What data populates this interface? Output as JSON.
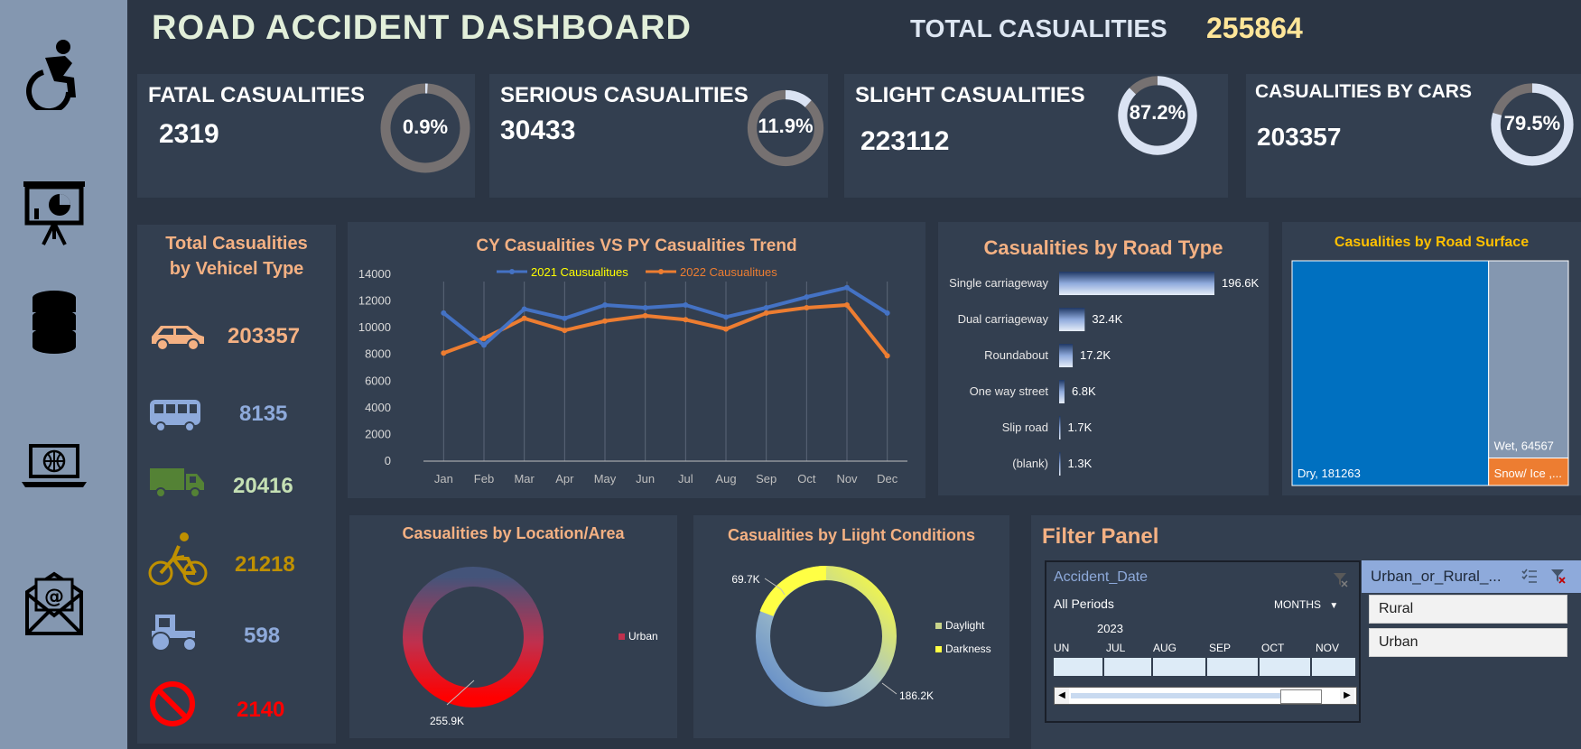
{
  "header": {
    "title": "ROAD ACCIDENT DASHBOARD",
    "total_label": "TOTAL CASUALITIES",
    "total_value": "255864"
  },
  "sidebar": {
    "icons": [
      "accessibility-icon",
      "presentation-chart-icon",
      "database-icon",
      "laptop-globe-icon",
      "email-icon"
    ]
  },
  "kpis": [
    {
      "title": "FATAL CASUALITIES",
      "value": "2319",
      "percent_label": "0.9%",
      "percent": 0.009
    },
    {
      "title": "SERIOUS CASUALITIES",
      "value": "30433",
      "percent_label": "11.9%",
      "percent": 0.119
    },
    {
      "title": "SLIGHT CASUALITIES",
      "value": "223112",
      "percent_label": "87.2%",
      "percent": 0.872
    },
    {
      "title": "CASUALITIES BY CARS",
      "value": "203357",
      "percent_label": "79.5%",
      "percent": 0.795
    }
  ],
  "vehicle_panel": {
    "title_line1": "Total Casualities",
    "title_line2": "by Vehicel Type",
    "items": [
      {
        "icon": "car-icon",
        "value": "203357",
        "color": "#f4b183"
      },
      {
        "icon": "bus-icon",
        "value": "8135",
        "color": "#8eaadb"
      },
      {
        "icon": "truck-icon",
        "value": "20416",
        "color": "#c5e0b4"
      },
      {
        "icon": "bicycle-icon",
        "value": "21218",
        "color": "#bf9000"
      },
      {
        "icon": "tractor-icon",
        "value": "598",
        "color": "#8eaadb"
      },
      {
        "icon": "no-entry-icon",
        "value": "2140",
        "color": "#ff0000"
      }
    ]
  },
  "chart_data": [
    {
      "type": "line",
      "title": "CY Casualities VS PY Casualities Trend",
      "categories": [
        "Jan",
        "Feb",
        "Mar",
        "Apr",
        "May",
        "Jun",
        "Jul",
        "Aug",
        "Sep",
        "Oct",
        "Nov",
        "Dec"
      ],
      "series": [
        {
          "name": "2021 Causualitues",
          "color": "#4472c4",
          "values": [
            11100,
            8700,
            11400,
            10700,
            11700,
            11500,
            11700,
            10800,
            11500,
            12300,
            13000,
            11100
          ]
        },
        {
          "name": "2022 Causualitues",
          "color": "#ed7d31",
          "values": [
            8100,
            9200,
            10700,
            9800,
            10500,
            10900,
            10600,
            9900,
            11100,
            11500,
            11700,
            7900
          ]
        }
      ],
      "ylim": [
        0,
        14000
      ],
      "yticks": [
        "0",
        "2000",
        "4000",
        "6000",
        "8000",
        "10000",
        "12000",
        "14000"
      ],
      "legend": "top",
      "grid": "vertical"
    },
    {
      "type": "bar",
      "title": "Casualities by Road Type",
      "categories": [
        "Single carriageway",
        "Dual carriageway",
        "Roundabout",
        "One way street",
        "Slip road",
        "(blank)"
      ],
      "values": [
        196600,
        32400,
        17200,
        6800,
        1700,
        1300
      ],
      "labels": [
        "196.6K",
        "32.4K",
        "17.2K",
        "6.8K",
        "1.7K",
        "1.3K"
      ],
      "orientation": "horizontal"
    },
    {
      "type": "treemap",
      "title": "Casualities by Road Surface",
      "categories": [
        "Dry",
        "Wet",
        "Snow/ Ice"
      ],
      "values": [
        181263,
        64567,
        9000
      ],
      "labels": [
        "Dry, 181263",
        "Wet, 64567",
        "Snow/ Ice ,..."
      ],
      "colors": [
        "#0070c0",
        "#8497b0",
        "#ed7d31"
      ]
    },
    {
      "type": "pie",
      "title": "Casualities by Location/Area",
      "categories": [
        "Urban"
      ],
      "values": [
        255900
      ],
      "labels": [
        "255.9K"
      ],
      "legend": [
        "Urban"
      ]
    },
    {
      "type": "pie",
      "title": "Casualities by Liight Conditions",
      "categories": [
        "Daylight",
        "Darkness"
      ],
      "values": [
        186200,
        69700
      ],
      "labels": [
        "186.2K",
        "69.7K"
      ],
      "legend": [
        "Daylight",
        "Darkness"
      ]
    }
  ],
  "filter_panel": {
    "title": "Filter Panel",
    "timeline": {
      "header": "Accident_Date",
      "periods": "All Periods",
      "level": "MONTHS",
      "year": "2023",
      "months": [
        "UN",
        "JUL",
        "AUG",
        "SEP",
        "OCT",
        "NOV"
      ]
    },
    "slicer": {
      "header": "Urban_or_Rural_...",
      "items": [
        "Rural",
        "Urban"
      ]
    }
  }
}
